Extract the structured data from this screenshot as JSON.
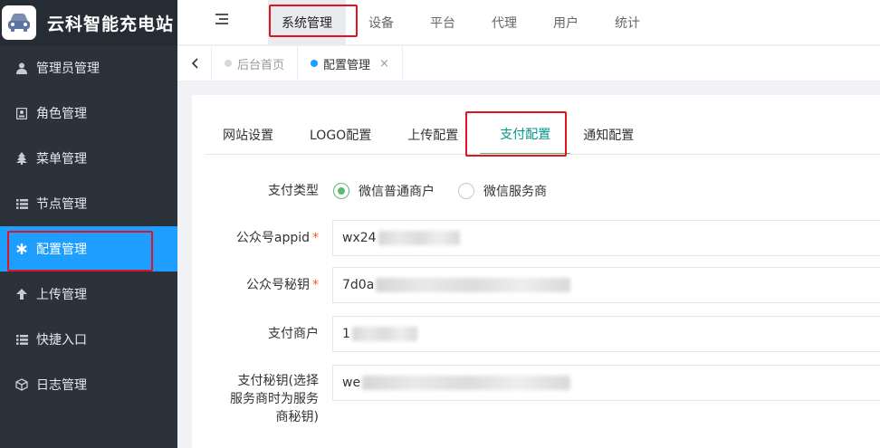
{
  "app": {
    "title": "云科智能充电站",
    "logo_icon": "car-icon"
  },
  "sidebar": {
    "items": [
      {
        "label": "管理员管理",
        "icon": "user-icon"
      },
      {
        "label": "角色管理",
        "icon": "id-card-icon"
      },
      {
        "label": "菜单管理",
        "icon": "tree-icon"
      },
      {
        "label": "节点管理",
        "icon": "list-icon"
      },
      {
        "label": "配置管理",
        "icon": "asterisk-icon",
        "active": true
      },
      {
        "label": "上传管理",
        "icon": "arrow-up-icon"
      },
      {
        "label": "快捷入口",
        "icon": "list-icon"
      },
      {
        "label": "日志管理",
        "icon": "cube-icon"
      }
    ]
  },
  "topnav": {
    "items": [
      "系统管理",
      "设备",
      "平台",
      "代理",
      "用户",
      "统计"
    ],
    "active": "系统管理"
  },
  "page_tabs": {
    "items": [
      {
        "label": "后台首页"
      },
      {
        "label": "配置管理",
        "active": true,
        "close": "×"
      }
    ]
  },
  "config_tabs": {
    "items": [
      "网站设置",
      "LOGO配置",
      "上传配置",
      "支付配置",
      "通知配置"
    ],
    "active": "支付配置"
  },
  "form": {
    "pay_type": {
      "label": "支付类型",
      "options": [
        "微信普通商户",
        "微信服务商"
      ],
      "selected": "微信普通商户"
    },
    "appid": {
      "label": "公众号appid",
      "required": true,
      "value_visible": "wx24"
    },
    "secret": {
      "label": "公众号秘钥",
      "required": true,
      "value_visible": "7d0a"
    },
    "merchant": {
      "label": "支付商户",
      "value_visible": "1"
    },
    "pay_key": {
      "label": "支付秘钥(选择服务商时为服务商秘钥)",
      "value_visible": "we"
    }
  },
  "colors": {
    "sidebar_bg": "#2b323a",
    "active_blue": "#1e9fff",
    "tab_active": "#009688",
    "radio_green": "#5fb878",
    "highlight_red": "#e0141e",
    "required_star": "#ff5722"
  }
}
